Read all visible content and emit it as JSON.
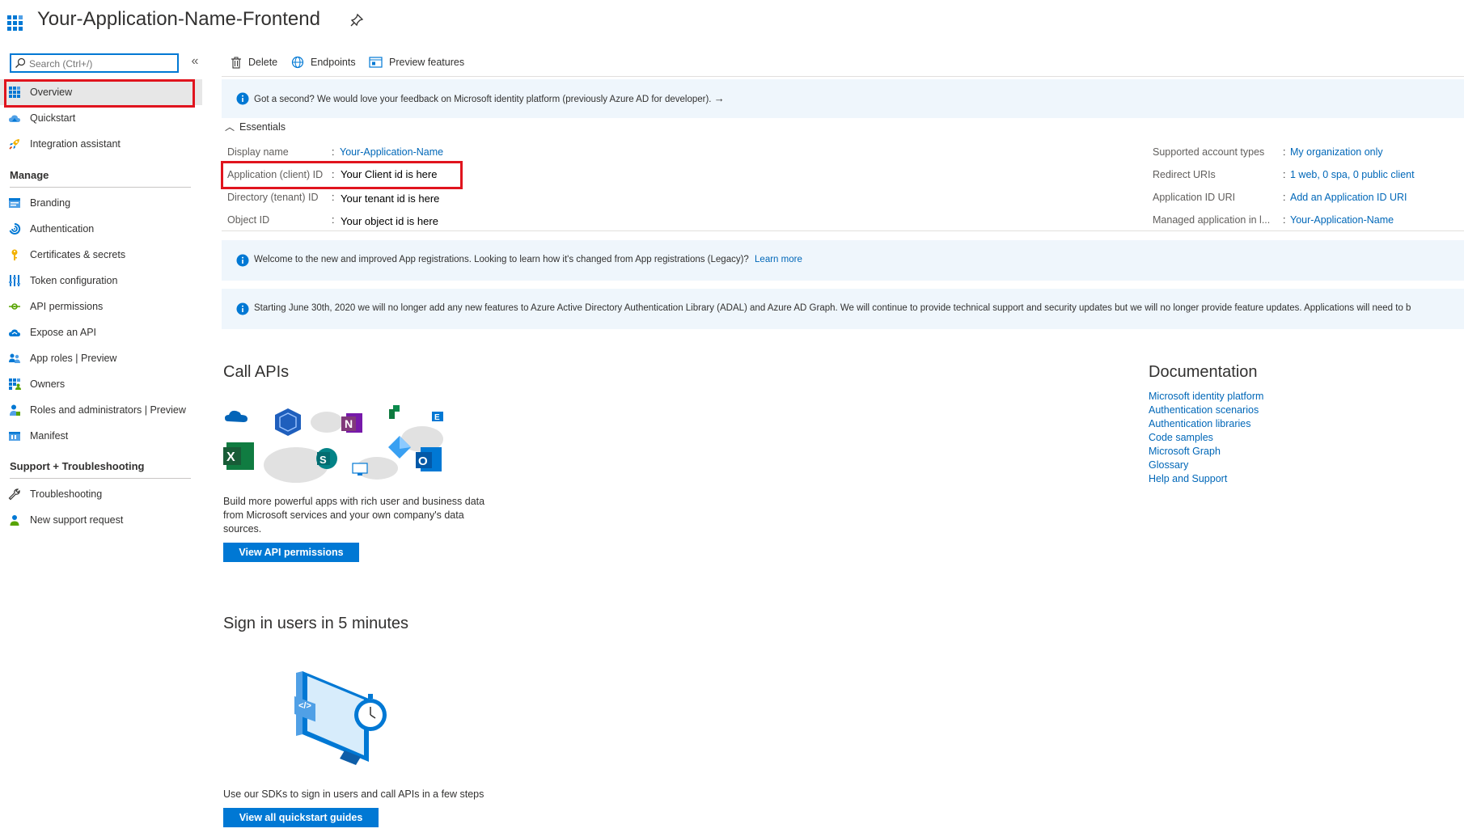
{
  "header": {
    "title": "Your-Application-Name-Frontend"
  },
  "sidebar": {
    "search_placeholder": "Search (Ctrl+/)",
    "collapse_glyph": "«",
    "items": [
      {
        "label": "Overview",
        "icon": "overview-grid-icon"
      },
      {
        "label": "Quickstart",
        "icon": "quickstart-cloud-icon"
      },
      {
        "label": "Integration assistant",
        "icon": "rocket-icon"
      }
    ],
    "manage_heading": "Manage",
    "manage_items": [
      {
        "label": "Branding",
        "icon": "branding-icon"
      },
      {
        "label": "Authentication",
        "icon": "authentication-icon"
      },
      {
        "label": "Certificates & secrets",
        "icon": "key-icon"
      },
      {
        "label": "Token configuration",
        "icon": "token-bars-icon"
      },
      {
        "label": "API permissions",
        "icon": "api-permissions-icon"
      },
      {
        "label": "Expose an API",
        "icon": "expose-cloud-icon"
      },
      {
        "label": "App roles | Preview",
        "icon": "app-roles-icon"
      },
      {
        "label": "Owners",
        "icon": "owners-grid-icon"
      },
      {
        "label": "Roles and administrators | Preview",
        "icon": "roles-person-icon"
      },
      {
        "label": "Manifest",
        "icon": "manifest-icon"
      }
    ],
    "support_heading": "Support + Troubleshooting",
    "support_items": [
      {
        "label": "Troubleshooting",
        "icon": "wrench-icon"
      },
      {
        "label": "New support request",
        "icon": "support-person-icon"
      }
    ]
  },
  "toolbar": {
    "delete_label": "Delete",
    "endpoints_label": "Endpoints",
    "preview_label": "Preview features"
  },
  "feedback_banner": {
    "text": "Got a second? We would love your feedback on Microsoft identity platform (previously Azure AD for developer).",
    "arrow": "→"
  },
  "essentials": {
    "heading": "Essentials",
    "left": [
      {
        "label": "Display name",
        "value": "Your-Application-Name",
        "is_link": true
      },
      {
        "label": "Application (client) ID",
        "value": "Your Client id is here",
        "is_link": false
      },
      {
        "label": "Directory (tenant) ID",
        "value": "Your tenant id is here",
        "is_link": false
      },
      {
        "label": "Object ID",
        "value": "Your object id is here",
        "is_link": false
      }
    ],
    "right": [
      {
        "label": "Supported account types",
        "value": "My organization only"
      },
      {
        "label": "Redirect URIs",
        "value": "1 web, 0 spa, 0 public client"
      },
      {
        "label": "Application ID URI",
        "value": "Add an Application ID URI"
      },
      {
        "label": "Managed application in l...",
        "value": "Your-Application-Name"
      }
    ]
  },
  "welcome_banner": {
    "text": "Welcome to the new and improved App registrations. Looking to learn how it's changed from App registrations (Legacy)?",
    "link": "Learn more"
  },
  "adal_banner": {
    "text": "Starting June 30th, 2020 we will no longer add any new features to Azure Active Directory Authentication Library (ADAL) and Azure AD Graph. We will continue to provide technical support and security updates but we will no longer provide feature updates. Applications will need to b"
  },
  "call_apis": {
    "heading": "Call APIs",
    "description": "Build more powerful apps with rich user and business data from Microsoft services and your own company's data sources.",
    "button": "View API permissions"
  },
  "documentation": {
    "heading": "Documentation",
    "links": [
      "Microsoft identity platform",
      "Authentication scenarios",
      "Authentication libraries",
      "Code samples",
      "Microsoft Graph",
      "Glossary",
      "Help and Support"
    ]
  },
  "sign_in": {
    "heading": "Sign in users in 5 minutes",
    "description": "Use our SDKs to sign in users and call APIs in a few steps",
    "button": "View all quickstart guides"
  },
  "colors": {
    "accent": "#0078d4",
    "link": "#0067b8",
    "highlight_box": "#e0141e",
    "banner_bg": "#eff6fc"
  }
}
